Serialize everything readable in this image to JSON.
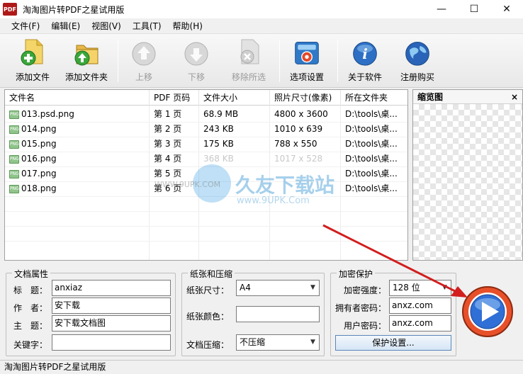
{
  "window": {
    "app_icon_text": "PDF",
    "title": "淘淘图片转PDF之星试用版",
    "minimize": "—",
    "maximize": "☐",
    "close": "✕"
  },
  "menu": [
    "文件(F)",
    "编辑(E)",
    "视图(V)",
    "工具(T)",
    "帮助(H)"
  ],
  "toolbar": {
    "add_file": "添加文件",
    "add_folder": "添加文件夹",
    "move_up": "上移",
    "move_down": "下移",
    "remove_selected": "移除所选",
    "options": "选项设置",
    "about": "关于软件",
    "register": "注册购买"
  },
  "file_list": {
    "columns": [
      "文件名",
      "PDF 页码",
      "文件大小",
      "照片尺寸(像素)",
      "所在文件夹"
    ],
    "icon_text": "PNG",
    "rows": [
      {
        "name": "013.psd.png",
        "page": "第 1 页",
        "size": "68.9 MB",
        "dims": "4800 x 3600",
        "folder": "D:\\tools\\桌..."
      },
      {
        "name": "014.png",
        "page": "第 2 页",
        "size": "243 KB",
        "dims": "1010 x 639",
        "folder": "D:\\tools\\桌..."
      },
      {
        "name": "015.png",
        "page": "第 3 页",
        "size": "175 KB",
        "dims": "788 x 550",
        "folder": "D:\\tools\\桌..."
      },
      {
        "name": "016.png",
        "page": "第 4 页",
        "size": "368 KB",
        "dims": "1017 x 528",
        "folder": "D:\\tools\\桌..."
      },
      {
        "name": "017.png",
        "page": "第 5 页",
        "size": "",
        "dims": "",
        "folder": "D:\\tools\\桌..."
      },
      {
        "name": "018.png",
        "page": "第 6 页",
        "size": "",
        "dims": "",
        "folder": "D:\\tools\\桌..."
      }
    ]
  },
  "thumbnail": {
    "title": "缩览图",
    "close": "×"
  },
  "doc_props": {
    "title": "文档属性",
    "title_label": "标　题：",
    "title_value": "anxiaz",
    "author_label": "作　者：",
    "author_value": "安下载",
    "subject_label": "主　题：",
    "subject_value": "安下载文档图",
    "keywords_label": "关键字：",
    "keywords_value": ""
  },
  "paper": {
    "title": "纸张和压缩",
    "size_label": "纸张尺寸：",
    "size_value": "A4",
    "color_label": "纸张颜色：",
    "compress_label": "文档压缩：",
    "compress_value": "不压缩"
  },
  "encryption": {
    "title": "加密保护",
    "strength_label": "加密强度：",
    "strength_value": "128 位",
    "owner_label": "拥有者密码：",
    "owner_value": "anxz.com",
    "user_label": "用户密码：",
    "user_value": "anxz.com",
    "settings_button": "保护设置..."
  },
  "watermark": {
    "main": "久友下载站",
    "sub": "www.9UPK.Com",
    "left": "WWW.9UPK.COM"
  },
  "status": "淘淘图片转PDF之星试用版",
  "colors": {
    "go_outer": "#e8502a",
    "go_inner": "#2f6fd6",
    "arrow": "#d21e1e"
  }
}
